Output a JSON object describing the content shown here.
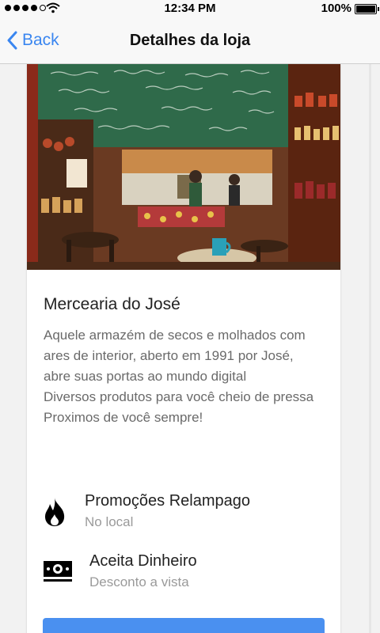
{
  "status_bar": {
    "time": "12:34 PM",
    "battery_percent": "100%"
  },
  "nav": {
    "back_label": "Back",
    "title": "Detalhes da loja"
  },
  "store": {
    "name": "Mercearia do José",
    "description_lines": [
      "Aquele armazém de secos e molhados com ares de interior, aberto em 1991 por José,",
      "abre suas portas ao mundo digital",
      "Diversos produtos para você cheio de pressa",
      "Proximos de você sempre!"
    ]
  },
  "features": [
    {
      "icon": "flame-icon",
      "title": "Promoções Relampago",
      "subtitle": "No local"
    },
    {
      "icon": "cash-icon",
      "title": "Aceita Dinheiro",
      "subtitle": "Desconto a vista"
    }
  ],
  "colors": {
    "accent": "#3a86f0",
    "button": "#4a90f0",
    "chalkboard": "#2f6a4a"
  }
}
